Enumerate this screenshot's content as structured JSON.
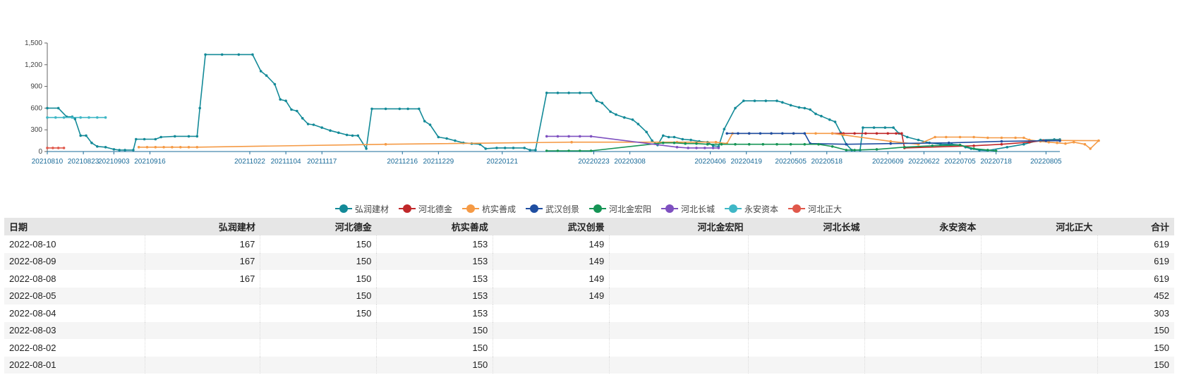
{
  "chart_data": {
    "type": "line",
    "ylim": [
      0,
      1500
    ],
    "yticks": [
      "0",
      "300",
      "600",
      "900",
      "1,200",
      "1,500"
    ],
    "ytick_values": [
      0,
      300,
      600,
      900,
      1200,
      1500
    ],
    "xlim": [
      "2021-08-10",
      "2022-08-10"
    ],
    "xticks": [
      "20210810",
      "20210823",
      "20210903",
      "20210916",
      "20211022",
      "20211104",
      "20211117",
      "20211216",
      "20211229",
      "20220121",
      "20220223",
      "20220308",
      "20220406",
      "20220419",
      "20220505",
      "20220518",
      "20220609",
      "20220622",
      "20220705",
      "20220718",
      "20220805"
    ],
    "title": "",
    "xlabel": "",
    "ylabel": "",
    "legend_position": "bottom-center",
    "series": [
      {
        "name": "弘润建材",
        "color": "#138a98",
        "points": [
          [
            "2021-08-10",
            600
          ],
          [
            "2021-08-14",
            600
          ],
          [
            "2021-08-17",
            480
          ],
          [
            "2021-08-19",
            480
          ],
          [
            "2021-08-20",
            450
          ],
          [
            "2021-08-22",
            220
          ],
          [
            "2021-08-24",
            220
          ],
          [
            "2021-08-26",
            120
          ],
          [
            "2021-08-28",
            70
          ],
          [
            "2021-08-31",
            60
          ],
          [
            "2021-09-03",
            30
          ],
          [
            "2021-09-05",
            20
          ],
          [
            "2021-09-07",
            20
          ],
          [
            "2021-09-10",
            20
          ],
          [
            "2021-09-11",
            170
          ],
          [
            "2021-09-14",
            170
          ],
          [
            "2021-09-18",
            170
          ],
          [
            "2021-09-20",
            200
          ],
          [
            "2021-09-25",
            210
          ],
          [
            "2021-09-30",
            210
          ],
          [
            "2021-10-03",
            210
          ],
          [
            "2021-10-04",
            600
          ],
          [
            "2021-10-06",
            1340
          ],
          [
            "2021-10-12",
            1340
          ],
          [
            "2021-10-18",
            1340
          ],
          [
            "2021-10-23",
            1340
          ],
          [
            "2021-10-26",
            1110
          ],
          [
            "2021-10-28",
            1050
          ],
          [
            "2021-10-31",
            930
          ],
          [
            "2021-11-02",
            720
          ],
          [
            "2021-11-04",
            700
          ],
          [
            "2021-11-06",
            580
          ],
          [
            "2021-11-08",
            560
          ],
          [
            "2021-11-10",
            460
          ],
          [
            "2021-11-12",
            380
          ],
          [
            "2021-11-14",
            370
          ],
          [
            "2021-11-17",
            330
          ],
          [
            "2021-11-20",
            290
          ],
          [
            "2021-11-23",
            260
          ],
          [
            "2021-11-26",
            230
          ],
          [
            "2021-11-28",
            220
          ],
          [
            "2021-11-30",
            220
          ],
          [
            "2021-12-03",
            40
          ],
          [
            "2021-12-05",
            590
          ],
          [
            "2021-12-10",
            590
          ],
          [
            "2021-12-15",
            590
          ],
          [
            "2021-12-18",
            590
          ],
          [
            "2021-12-22",
            590
          ],
          [
            "2021-12-24",
            420
          ],
          [
            "2021-12-26",
            370
          ],
          [
            "2021-12-29",
            200
          ],
          [
            "2022-01-01",
            180
          ],
          [
            "2022-01-04",
            150
          ],
          [
            "2022-01-07",
            120
          ],
          [
            "2022-01-10",
            110
          ],
          [
            "2022-01-13",
            100
          ],
          [
            "2022-01-15",
            40
          ],
          [
            "2022-01-19",
            50
          ],
          [
            "2022-01-22",
            50
          ],
          [
            "2022-01-25",
            50
          ],
          [
            "2022-01-29",
            50
          ],
          [
            "2022-01-31",
            20
          ],
          [
            "2022-02-02",
            20
          ],
          [
            "2022-02-06",
            810
          ],
          [
            "2022-02-10",
            810
          ],
          [
            "2022-02-14",
            810
          ],
          [
            "2022-02-18",
            810
          ],
          [
            "2022-02-22",
            810
          ],
          [
            "2022-02-24",
            700
          ],
          [
            "2022-02-26",
            670
          ],
          [
            "2022-03-01",
            550
          ],
          [
            "2022-03-03",
            510
          ],
          [
            "2022-03-06",
            470
          ],
          [
            "2022-03-09",
            440
          ],
          [
            "2022-03-11",
            380
          ],
          [
            "2022-03-14",
            270
          ],
          [
            "2022-03-16",
            150
          ],
          [
            "2022-03-18",
            90
          ],
          [
            "2022-03-20",
            220
          ],
          [
            "2022-03-22",
            200
          ],
          [
            "2022-03-24",
            200
          ],
          [
            "2022-03-27",
            170
          ],
          [
            "2022-03-30",
            160
          ],
          [
            "2022-04-02",
            140
          ],
          [
            "2022-04-05",
            130
          ],
          [
            "2022-04-07",
            80
          ],
          [
            "2022-04-09",
            70
          ],
          [
            "2022-04-11",
            310
          ],
          [
            "2022-04-15",
            600
          ],
          [
            "2022-04-18",
            700
          ],
          [
            "2022-04-22",
            700
          ],
          [
            "2022-04-26",
            700
          ],
          [
            "2022-04-30",
            700
          ],
          [
            "2022-05-02",
            680
          ],
          [
            "2022-05-05",
            640
          ],
          [
            "2022-05-08",
            610
          ],
          [
            "2022-05-10",
            600
          ],
          [
            "2022-05-12",
            580
          ],
          [
            "2022-05-14",
            520
          ],
          [
            "2022-05-16",
            490
          ],
          [
            "2022-05-19",
            440
          ],
          [
            "2022-05-21",
            410
          ],
          [
            "2022-05-23",
            260
          ],
          [
            "2022-05-25",
            100
          ],
          [
            "2022-05-27",
            20
          ],
          [
            "2022-05-30",
            20
          ],
          [
            "2022-05-31",
            330
          ],
          [
            "2022-06-04",
            330
          ],
          [
            "2022-06-08",
            330
          ],
          [
            "2022-06-11",
            330
          ],
          [
            "2022-06-13",
            250
          ],
          [
            "2022-06-16",
            200
          ],
          [
            "2022-06-20",
            160
          ],
          [
            "2022-06-24",
            120
          ],
          [
            "2022-06-28",
            100
          ],
          [
            "2022-07-02",
            100
          ],
          [
            "2022-07-05",
            90
          ],
          [
            "2022-07-07",
            60
          ],
          [
            "2022-07-09",
            40
          ],
          [
            "2022-07-12",
            20
          ],
          [
            "2022-07-15",
            15
          ],
          [
            "2022-07-22",
            60
          ],
          [
            "2022-07-28",
            100
          ],
          [
            "2022-08-03",
            160
          ],
          [
            "2022-08-08",
            167
          ],
          [
            "2022-08-10",
            167
          ]
        ]
      },
      {
        "name": "河北德金",
        "color": "#c0282a",
        "points": [
          [
            "2022-05-20",
            250
          ],
          [
            "2022-05-24",
            250
          ],
          [
            "2022-05-28",
            250
          ],
          [
            "2022-06-01",
            250
          ],
          [
            "2022-06-05",
            250
          ],
          [
            "2022-06-09",
            250
          ],
          [
            "2022-06-12",
            250
          ],
          [
            "2022-06-14",
            250
          ],
          [
            "2022-06-15",
            50
          ],
          [
            "2022-07-10",
            80
          ],
          [
            "2022-07-20",
            100
          ],
          [
            "2022-07-30",
            130
          ],
          [
            "2022-08-04",
            150
          ],
          [
            "2022-08-10",
            150
          ]
        ]
      },
      {
        "name": "杭实善成",
        "color": "#f59a45",
        "points": [
          [
            "2021-09-12",
            60
          ],
          [
            "2021-09-15",
            60
          ],
          [
            "2021-09-18",
            60
          ],
          [
            "2021-09-21",
            60
          ],
          [
            "2021-09-24",
            60
          ],
          [
            "2021-09-27",
            60
          ],
          [
            "2021-09-30",
            60
          ],
          [
            "2021-10-03",
            60
          ],
          [
            "2021-12-10",
            100
          ],
          [
            "2022-02-15",
            130
          ],
          [
            "2022-03-25",
            130
          ],
          [
            "2022-04-08",
            130
          ],
          [
            "2022-04-12",
            110
          ],
          [
            "2022-04-14",
            250
          ],
          [
            "2022-04-20",
            250
          ],
          [
            "2022-04-28",
            250
          ],
          [
            "2022-05-06",
            250
          ],
          [
            "2022-05-14",
            250
          ],
          [
            "2022-05-20",
            250
          ],
          [
            "2022-05-24",
            230
          ],
          [
            "2022-06-10",
            140
          ],
          [
            "2022-06-20",
            100
          ],
          [
            "2022-06-26",
            200
          ],
          [
            "2022-06-30",
            200
          ],
          [
            "2022-07-05",
            200
          ],
          [
            "2022-07-10",
            200
          ],
          [
            "2022-07-15",
            190
          ],
          [
            "2022-07-20",
            190
          ],
          [
            "2022-07-25",
            190
          ],
          [
            "2022-07-28",
            190
          ],
          [
            "2022-07-30",
            160
          ],
          [
            "2022-08-03",
            140
          ],
          [
            "2022-08-06",
            130
          ],
          [
            "2022-08-09",
            120
          ],
          [
            "2022-08-12",
            110
          ],
          [
            "2022-08-15",
            130
          ],
          [
            "2022-08-19",
            100
          ],
          [
            "2022-08-21",
            40
          ],
          [
            "2022-08-24",
            150
          ],
          [
            "2022-08-10",
            153
          ]
        ]
      },
      {
        "name": "武汉创景",
        "color": "#1f4ea1",
        "points": [
          [
            "2022-04-12",
            250
          ],
          [
            "2022-04-16",
            250
          ],
          [
            "2022-04-20",
            250
          ],
          [
            "2022-04-24",
            250
          ],
          [
            "2022-04-28",
            250
          ],
          [
            "2022-05-02",
            250
          ],
          [
            "2022-05-06",
            250
          ],
          [
            "2022-05-10",
            250
          ],
          [
            "2022-05-12",
            110
          ],
          [
            "2022-05-25",
            100
          ],
          [
            "2022-06-10",
            110
          ],
          [
            "2022-07-01",
            120
          ],
          [
            "2022-07-20",
            140
          ],
          [
            "2022-08-05",
            149
          ],
          [
            "2022-08-10",
            149
          ]
        ]
      },
      {
        "name": "河北金宏阳",
        "color": "#159455",
        "points": [
          [
            "2022-02-06",
            10
          ],
          [
            "2022-02-10",
            10
          ],
          [
            "2022-02-14",
            10
          ],
          [
            "2022-02-18",
            10
          ],
          [
            "2022-02-22",
            10
          ],
          [
            "2022-03-20",
            120
          ],
          [
            "2022-03-24",
            120
          ],
          [
            "2022-03-28",
            110
          ],
          [
            "2022-04-01",
            110
          ],
          [
            "2022-04-05",
            100
          ],
          [
            "2022-04-10",
            100
          ],
          [
            "2022-04-15",
            100
          ],
          [
            "2022-04-20",
            100
          ],
          [
            "2022-04-25",
            100
          ],
          [
            "2022-04-30",
            100
          ],
          [
            "2022-05-05",
            100
          ],
          [
            "2022-05-10",
            100
          ],
          [
            "2022-05-15",
            100
          ],
          [
            "2022-05-20",
            70
          ],
          [
            "2022-05-25",
            20
          ],
          [
            "2022-05-28",
            20
          ],
          [
            "2022-06-05",
            30
          ],
          [
            "2022-06-15",
            60
          ],
          [
            "2022-06-25",
            80
          ],
          [
            "2022-07-05",
            90
          ],
          [
            "2022-07-10",
            40
          ],
          [
            "2022-07-15",
            20
          ],
          [
            "2022-07-18",
            10
          ]
        ]
      },
      {
        "name": "河北长城",
        "color": "#7e50c0",
        "points": [
          [
            "2022-02-06",
            210
          ],
          [
            "2022-02-10",
            210
          ],
          [
            "2022-02-14",
            210
          ],
          [
            "2022-02-18",
            210
          ],
          [
            "2022-02-22",
            210
          ],
          [
            "2022-03-25",
            60
          ],
          [
            "2022-03-29",
            50
          ],
          [
            "2022-04-01",
            50
          ],
          [
            "2022-04-04",
            50
          ],
          [
            "2022-04-07",
            50
          ],
          [
            "2022-04-09",
            50
          ]
        ]
      },
      {
        "name": "永安资本",
        "color": "#3fb7c6",
        "points": [
          [
            "2021-08-10",
            470
          ],
          [
            "2021-08-13",
            470
          ],
          [
            "2021-08-16",
            470
          ],
          [
            "2021-08-19",
            470
          ],
          [
            "2021-08-22",
            470
          ],
          [
            "2021-08-25",
            470
          ],
          [
            "2021-08-28",
            470
          ],
          [
            "2021-08-31",
            470
          ]
        ]
      },
      {
        "name": "河北正大",
        "color": "#e0584b",
        "points": [
          [
            "2021-08-10",
            50
          ],
          [
            "2021-08-12",
            50
          ],
          [
            "2021-08-14",
            50
          ],
          [
            "2021-08-16",
            50
          ]
        ]
      }
    ]
  },
  "table": {
    "headers": [
      "日期",
      "弘润建材",
      "河北德金",
      "杭实善成",
      "武汉创景",
      "河北金宏阳",
      "河北长城",
      "永安资本",
      "河北正大",
      "合计"
    ],
    "rows": [
      [
        "2022-08-10",
        "167",
        "150",
        "153",
        "149",
        "",
        "",
        "",
        "",
        "619"
      ],
      [
        "2022-08-09",
        "167",
        "150",
        "153",
        "149",
        "",
        "",
        "",
        "",
        "619"
      ],
      [
        "2022-08-08",
        "167",
        "150",
        "153",
        "149",
        "",
        "",
        "",
        "",
        "619"
      ],
      [
        "2022-08-05",
        "",
        "150",
        "153",
        "149",
        "",
        "",
        "",
        "",
        "452"
      ],
      [
        "2022-08-04",
        "",
        "150",
        "153",
        "",
        "",
        "",
        "",
        "",
        "303"
      ],
      [
        "2022-08-03",
        "",
        "",
        "150",
        "",
        "",
        "",
        "",
        "",
        "150"
      ],
      [
        "2022-08-02",
        "",
        "",
        "150",
        "",
        "",
        "",
        "",
        "",
        "150"
      ],
      [
        "2022-08-01",
        "",
        "",
        "150",
        "",
        "",
        "",
        "",
        "",
        "150"
      ]
    ]
  }
}
